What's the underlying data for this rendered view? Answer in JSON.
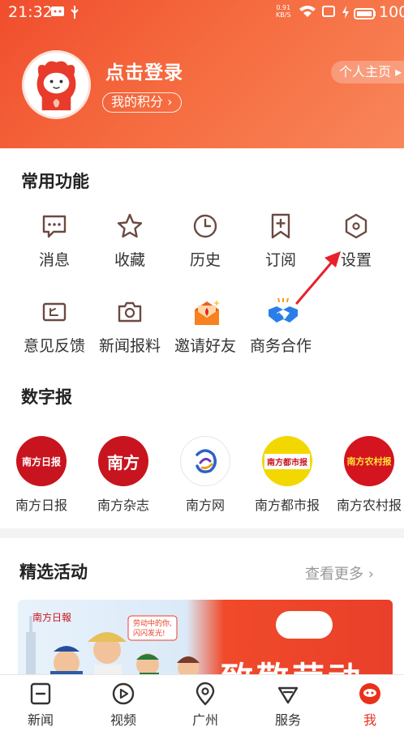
{
  "status_bar": {
    "time": "21:32",
    "speed_value": "0.91",
    "speed_unit": "KB/S",
    "battery": "100"
  },
  "header": {
    "login_title": "点击登录",
    "points_label": "我的积分 ›",
    "profile_label": "个人主页 ▸"
  },
  "common_functions": {
    "title": "常用功能",
    "items": [
      {
        "label": "消息",
        "icon": "message-icon"
      },
      {
        "label": "收藏",
        "icon": "star-icon"
      },
      {
        "label": "历史",
        "icon": "clock-icon"
      },
      {
        "label": "订阅",
        "icon": "subscribe-icon"
      },
      {
        "label": "设置",
        "icon": "settings-icon"
      },
      {
        "label": "意见反馈",
        "icon": "feedback-icon"
      },
      {
        "label": "新闻报料",
        "icon": "camera-icon"
      },
      {
        "label": "邀请好友",
        "icon": "invite-icon"
      },
      {
        "label": "商务合作",
        "icon": "handshake-icon"
      }
    ]
  },
  "digital_papers": {
    "title": "数字报",
    "items": [
      {
        "label": "南方日报",
        "logo_text": "南方日报",
        "color": "#c8141e"
      },
      {
        "label": "南方杂志",
        "logo_text": "南方",
        "color": "#c8141e"
      },
      {
        "label": "南方网",
        "logo_text": "",
        "color": "#ffffff"
      },
      {
        "label": "南方都市报",
        "logo_text": "南方都市报",
        "color": "#f2d800"
      },
      {
        "label": "南方农村报",
        "logo_text": "南方农村报",
        "color": "#d4141e"
      }
    ]
  },
  "activities": {
    "title": "精选活动",
    "more_label": "查看更多 ›",
    "banner_text": "致敬劳动者"
  },
  "tabbar": {
    "items": [
      {
        "label": "新闻",
        "icon": "news-icon"
      },
      {
        "label": "视频",
        "icon": "video-icon"
      },
      {
        "label": "广州",
        "icon": "location-icon"
      },
      {
        "label": "服务",
        "icon": "service-icon"
      },
      {
        "label": "我",
        "icon": "me-icon"
      }
    ]
  },
  "colors": {
    "accent": "#e9311a",
    "icon": "#6b4a42"
  }
}
